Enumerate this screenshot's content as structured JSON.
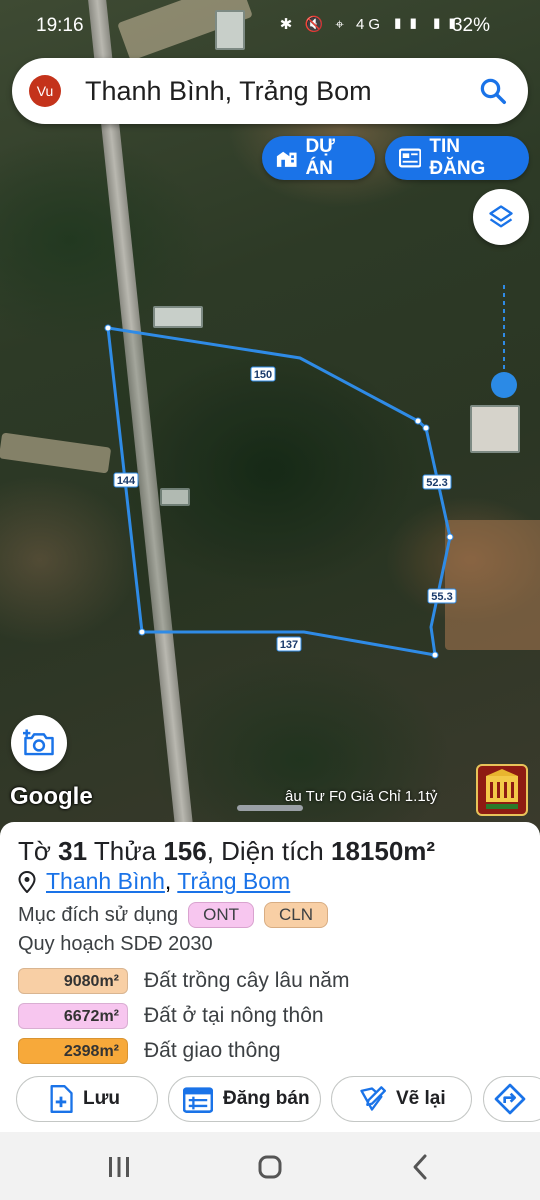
{
  "status_bar": {
    "time": "19:16",
    "icons": "✱ 🔇 ⌖ 4G ▮▮ ▮▮",
    "battery": "32%"
  },
  "search": {
    "avatar": "Vu",
    "title": "Thanh Bình, Trảng Bom"
  },
  "chips": {
    "projects": "DỰ ÁN",
    "listings": "TIN ĐĂNG"
  },
  "map": {
    "edge_labels": [
      "150",
      "52.3",
      "55.3",
      "137",
      "144"
    ],
    "attribution": "Google",
    "ticker": "âu Tư F0 Giá Chỉ 1.1tỷ"
  },
  "sheet": {
    "title_prefix": "Tờ",
    "sheet_no": "31",
    "parcel_word": "Thửa",
    "parcel_no": "156",
    "area_word": ", Diện tích",
    "area": "18150m²",
    "ward": "Thanh Bình",
    "separator": ",",
    "district": "Trảng Bom",
    "purpose_label": "Mục đích sử dụng",
    "purpose_tags": [
      "ONT",
      "CLN"
    ],
    "plan_label": "Quy hoạch SDĐ 2030",
    "zones": [
      {
        "amount": "9080m²",
        "label": "Đất trồng cây lâu năm",
        "color": "#f8cfa5"
      },
      {
        "amount": "6672m²",
        "label": "Đất ở tại nông thôn",
        "color": "#f7c6ef"
      },
      {
        "amount": "2398m²",
        "label": "Đất giao thông",
        "color": "#f7a93a"
      }
    ],
    "actions": {
      "save": "Lưu",
      "sell": "Đăng bán",
      "redraw": "Vẽ lại"
    }
  },
  "colors": {
    "accent": "#1a73e8",
    "polygon": "#2f8be6"
  }
}
